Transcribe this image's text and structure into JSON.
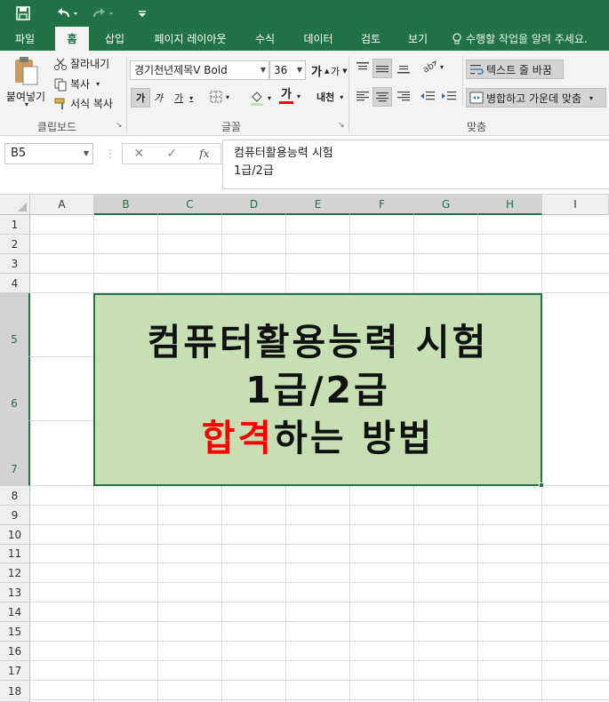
{
  "quick_access": {
    "save_icon": "save-icon",
    "undo_icon": "undo-icon",
    "redo_icon": "redo-icon",
    "customize_icon": "customize-icon"
  },
  "tabs": [
    {
      "label": "파일"
    },
    {
      "label": "홈"
    },
    {
      "label": "삽입"
    },
    {
      "label": "페이지 레이아웃"
    },
    {
      "label": "수식"
    },
    {
      "label": "데이터"
    },
    {
      "label": "검토"
    },
    {
      "label": "보기"
    }
  ],
  "tell_me": "수행할 작업을 알려 주세요.",
  "ribbon": {
    "clipboard": {
      "paste": "붙여넣기",
      "cut": "잘라내기",
      "copy": "복사",
      "format_painter": "서식 복사",
      "label": "클립보드"
    },
    "font": {
      "name": "경기천년제목V Bold",
      "size": "36",
      "grow": "가",
      "shrink": "가",
      "bold": "가",
      "italic": "가",
      "underline": "가",
      "font_color_glyph": "가",
      "phonetic": "내천",
      "label": "글꼴"
    },
    "alignment": {
      "wrap_text": "텍스트 줄 바꿈",
      "merge_center": "병합하고 가운데 맞춤",
      "label": "맞춤"
    }
  },
  "formula_bar": {
    "name_box": "B5",
    "fx": "fx",
    "content_line1": "컴퓨터활용능력 시험",
    "content_line2": "1급/2급"
  },
  "columns": [
    "A",
    "B",
    "C",
    "D",
    "E",
    "F",
    "G",
    "H",
    "I"
  ],
  "rows": [
    "1",
    "2",
    "3",
    "4",
    "5",
    "6",
    "7",
    "8",
    "9",
    "10",
    "11",
    "12",
    "13",
    "14",
    "15",
    "16",
    "17",
    "18"
  ],
  "cell": {
    "line1": "컴퓨터활용능력 시험",
    "line2": "1급/2급",
    "line3_red": "합격",
    "line3_rest": "하는 방법"
  },
  "colors": {
    "accent": "#217346",
    "cell_fill": "#c6e0b4",
    "highlight_red": "#ff0000"
  }
}
